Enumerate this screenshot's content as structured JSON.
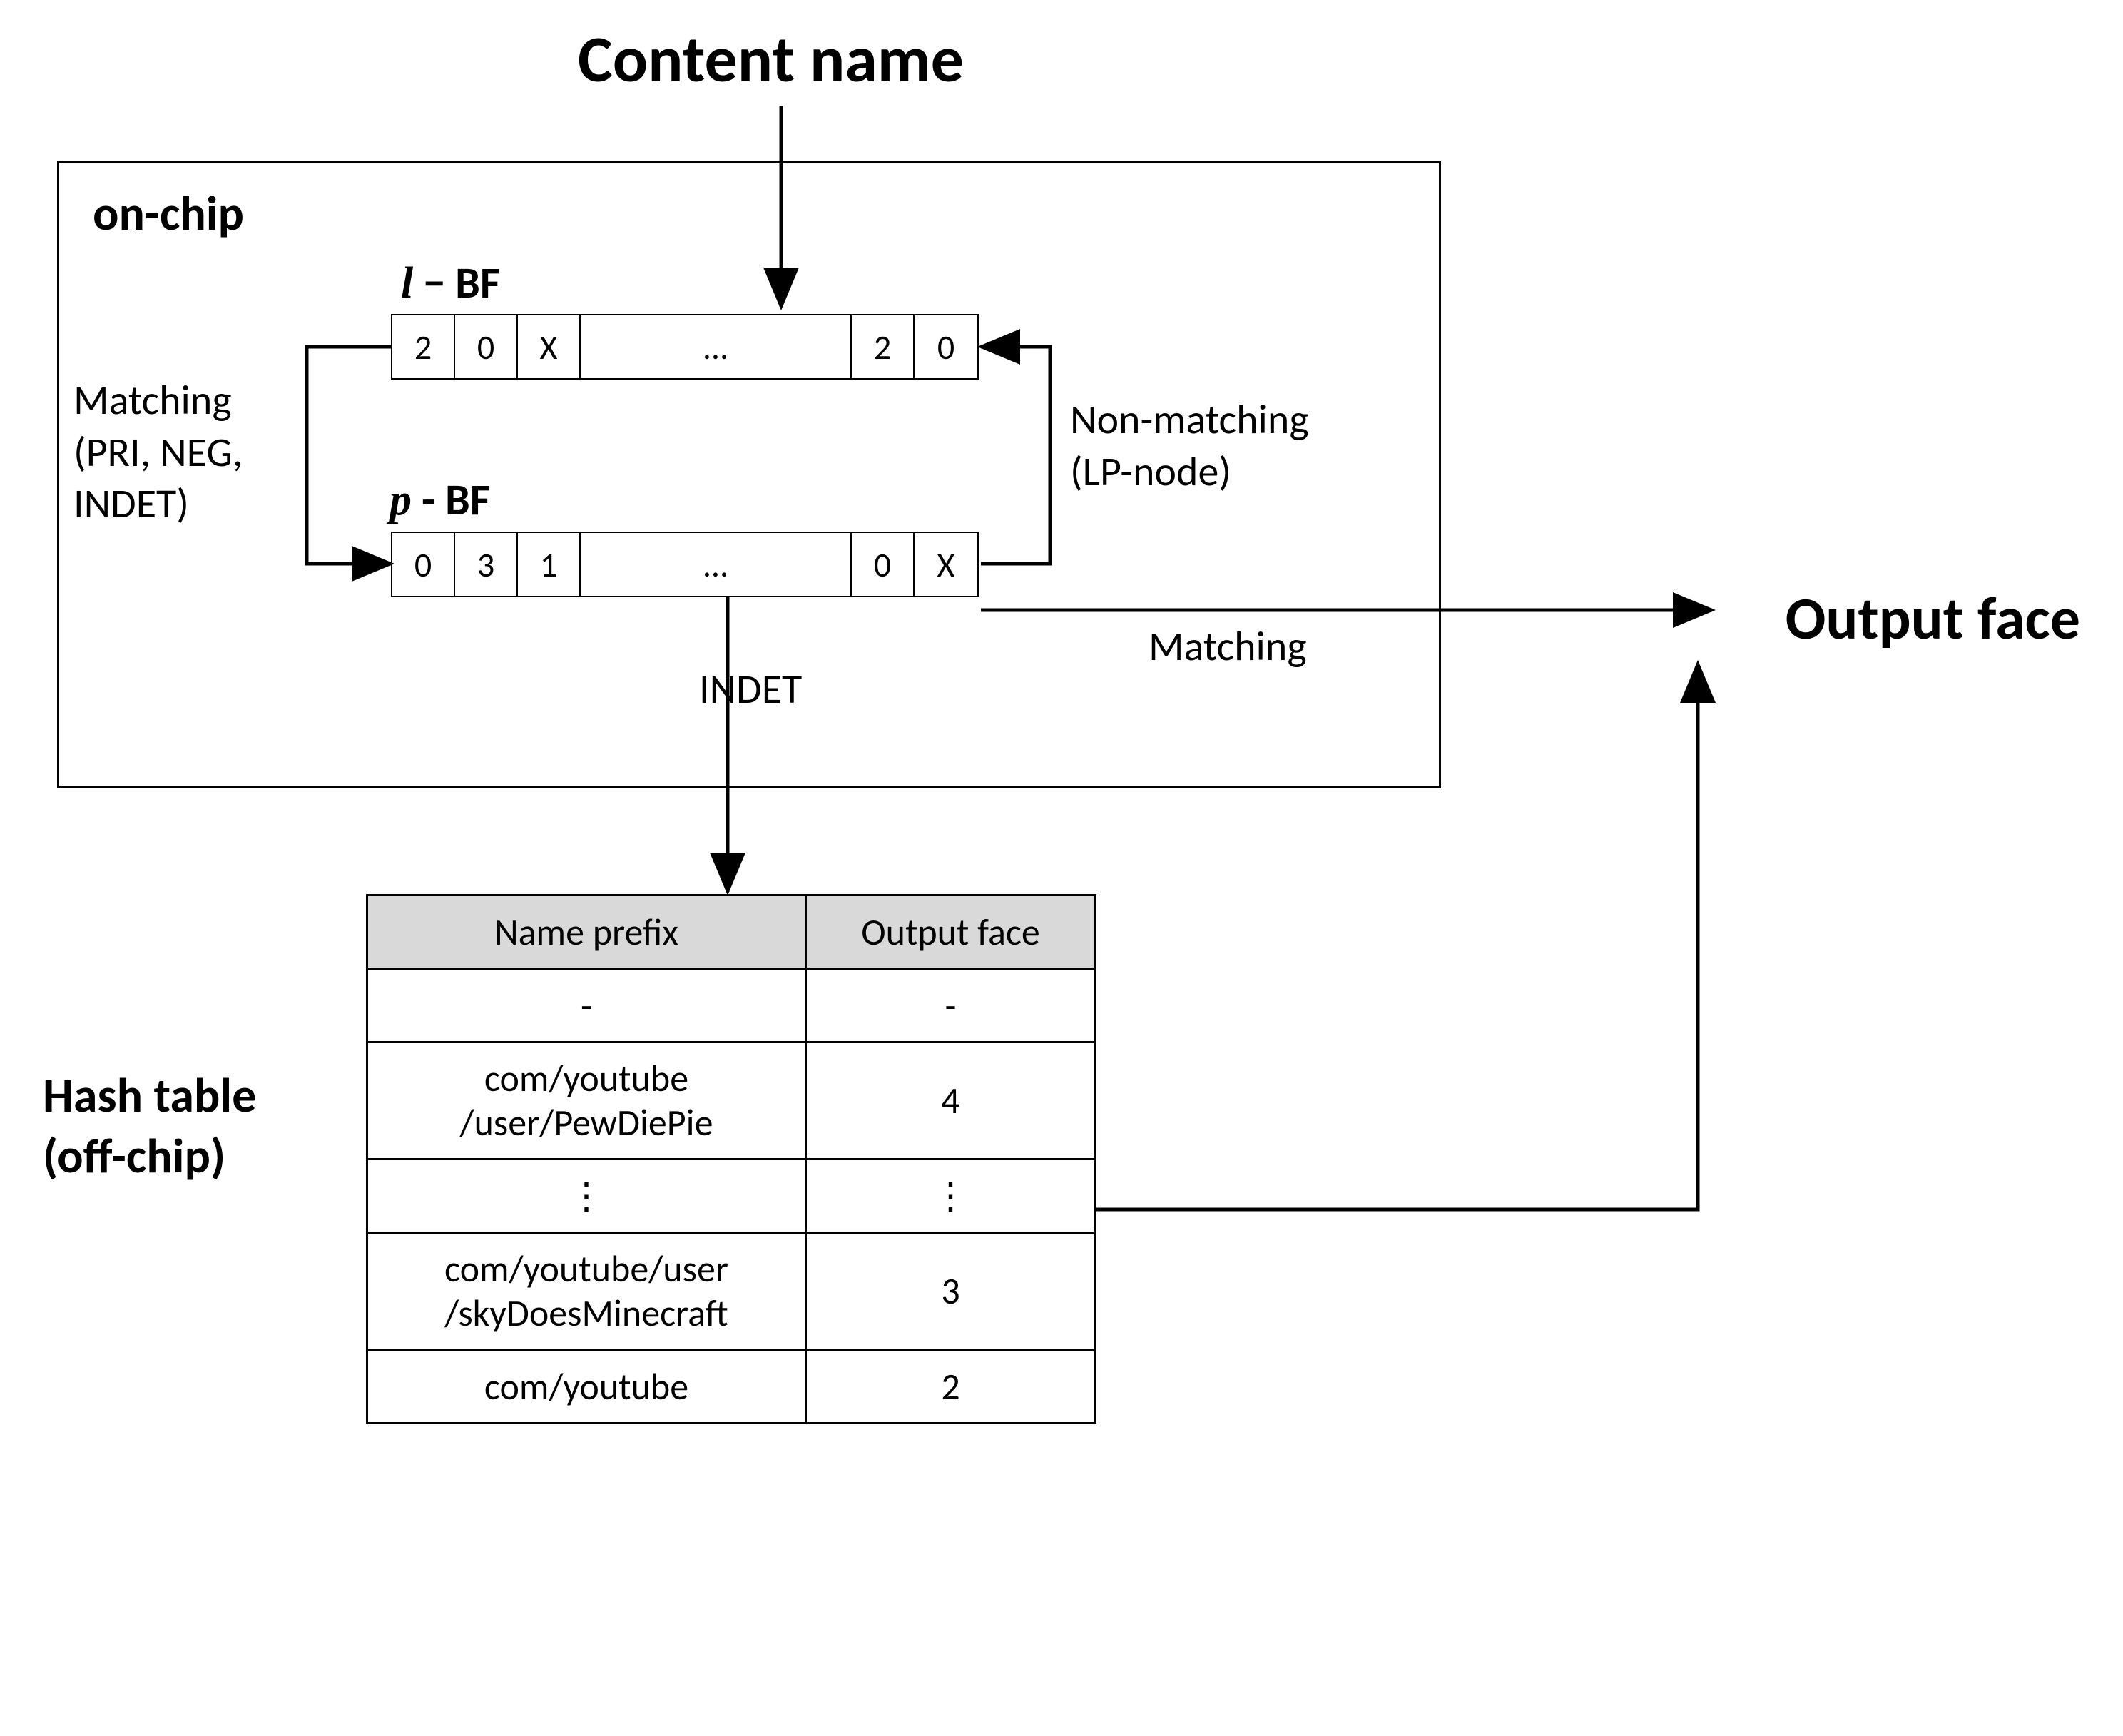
{
  "title": "Content name",
  "output_face_label": "Output face",
  "on_chip_label": "on-chip",
  "matching_left": "Matching\n(PRI, NEG,\nINDET)",
  "nonmatching": "Non-matching\n(LP-node)",
  "matching_right": "Matching",
  "indet_label": "INDET",
  "l_bf_label_var": "l",
  "l_bf_label_rest": " − BF",
  "p_bf_label_var": "p",
  "p_bf_label_rest": " - BF",
  "l_bf_cells": [
    "2",
    "0",
    "X",
    "...",
    "2",
    "0"
  ],
  "p_bf_cells": [
    "0",
    "3",
    "1",
    "...",
    "0",
    "X"
  ],
  "hash_label": "Hash table\n(off-chip)",
  "hash_table": {
    "headers": [
      "Name prefix",
      "Output face"
    ],
    "rows": [
      {
        "prefix": "-",
        "face": "-"
      },
      {
        "prefix": "com/youtube\n/user/PewDiePie",
        "face": "4"
      },
      {
        "prefix": "⋮",
        "face": "⋮"
      },
      {
        "prefix": "com/youtube/user\n/skyDoesMinecraft",
        "face": "3"
      },
      {
        "prefix": "com/youtube",
        "face": "2"
      }
    ]
  }
}
